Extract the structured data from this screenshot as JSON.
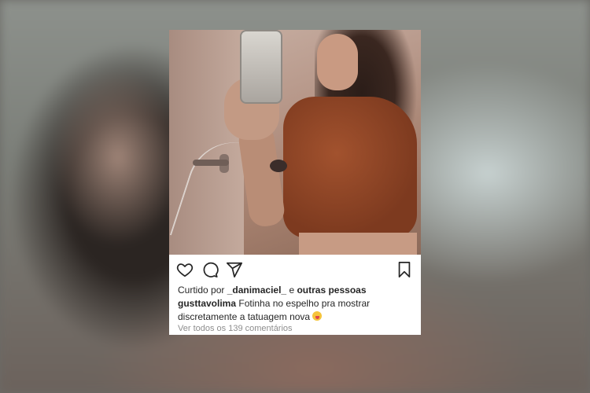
{
  "post": {
    "liked_by_prefix": "Curtido por",
    "liked_by_user": "_danimaciel_",
    "liked_by_connector": "e",
    "liked_by_others": "outras pessoas",
    "caption_user": "gusttavolima",
    "caption_text": "Fotinha no espelho pra mostrar discretamente a tatuagem nova",
    "caption_emoji": "winking-face-with-tongue",
    "view_comments": "Ver todos os 139 comentários"
  },
  "icons": {
    "like": "heart-icon",
    "comment": "comment-icon",
    "share": "send-icon",
    "save": "bookmark-icon"
  },
  "colors": {
    "text": "#262626",
    "muted": "#8e8e8e",
    "card": "#ffffff"
  }
}
